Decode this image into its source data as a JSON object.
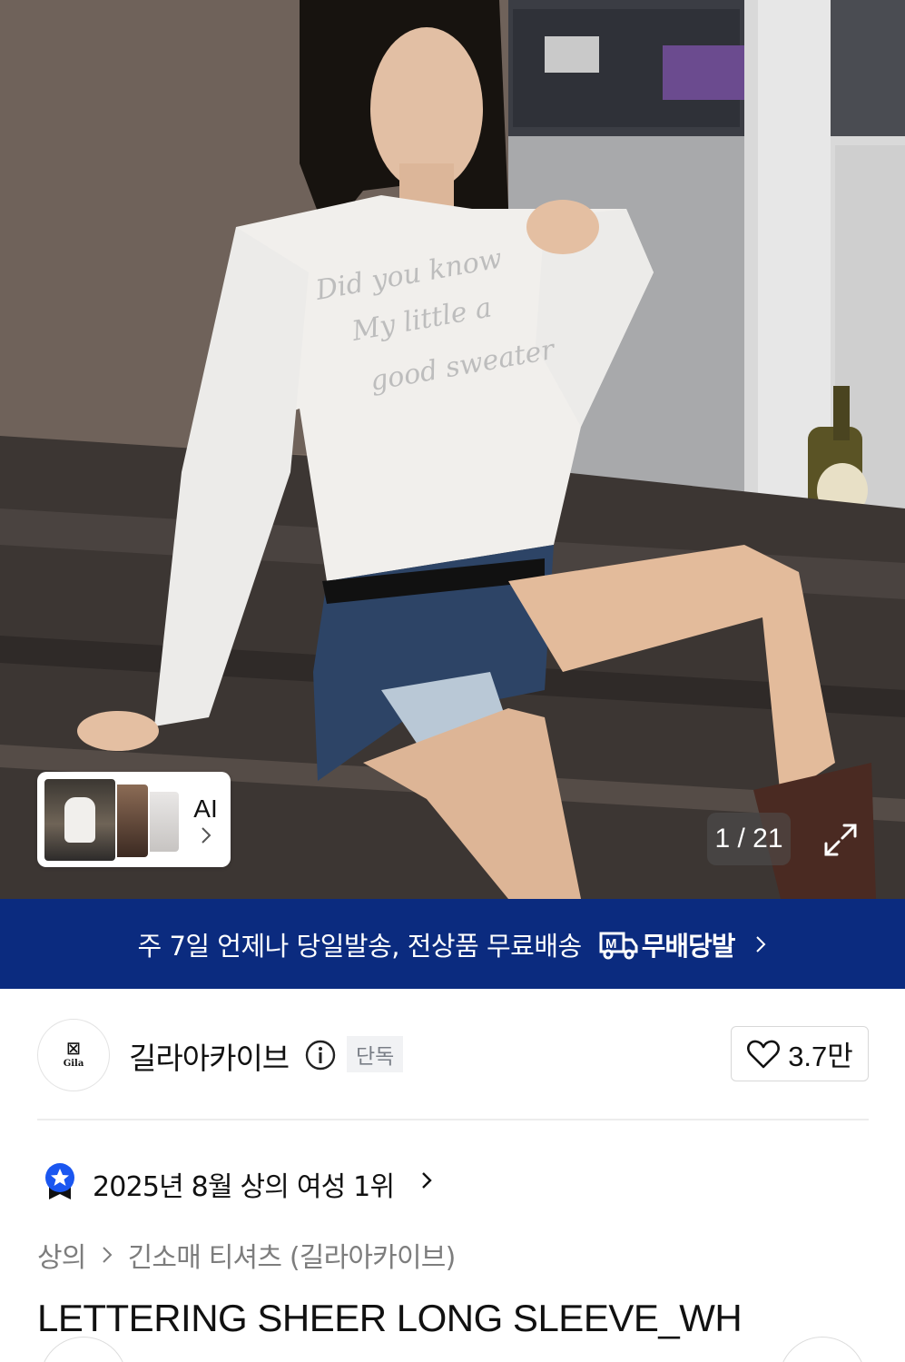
{
  "gallery": {
    "current": 1,
    "total": 21,
    "counter_text": "1 / 21",
    "ai_label": "AI"
  },
  "banner": {
    "text": "주 7일 언제나 당일발송, 전상품 무료배송",
    "brand": "무배당발",
    "color": "#0b2b7f"
  },
  "store": {
    "logo_mark": "☒",
    "logo_text": "Gila",
    "name": "길라아카이브",
    "badge": "단독",
    "likes": "3.7만"
  },
  "ranking": {
    "text": "2025년 8월 상의 여성 1위",
    "badge_color": "#1a56f0"
  },
  "breadcrumb": {
    "category": "상의",
    "subcategory": "긴소매 티셔츠 (길라아카이브)"
  },
  "product": {
    "title": "LETTERING SHEER LONG SLEEVE_WH"
  },
  "icons": [
    "chevron-right-icon",
    "expand-icon",
    "info-icon",
    "heart-icon",
    "ranking-badge-icon",
    "truck-icon"
  ]
}
